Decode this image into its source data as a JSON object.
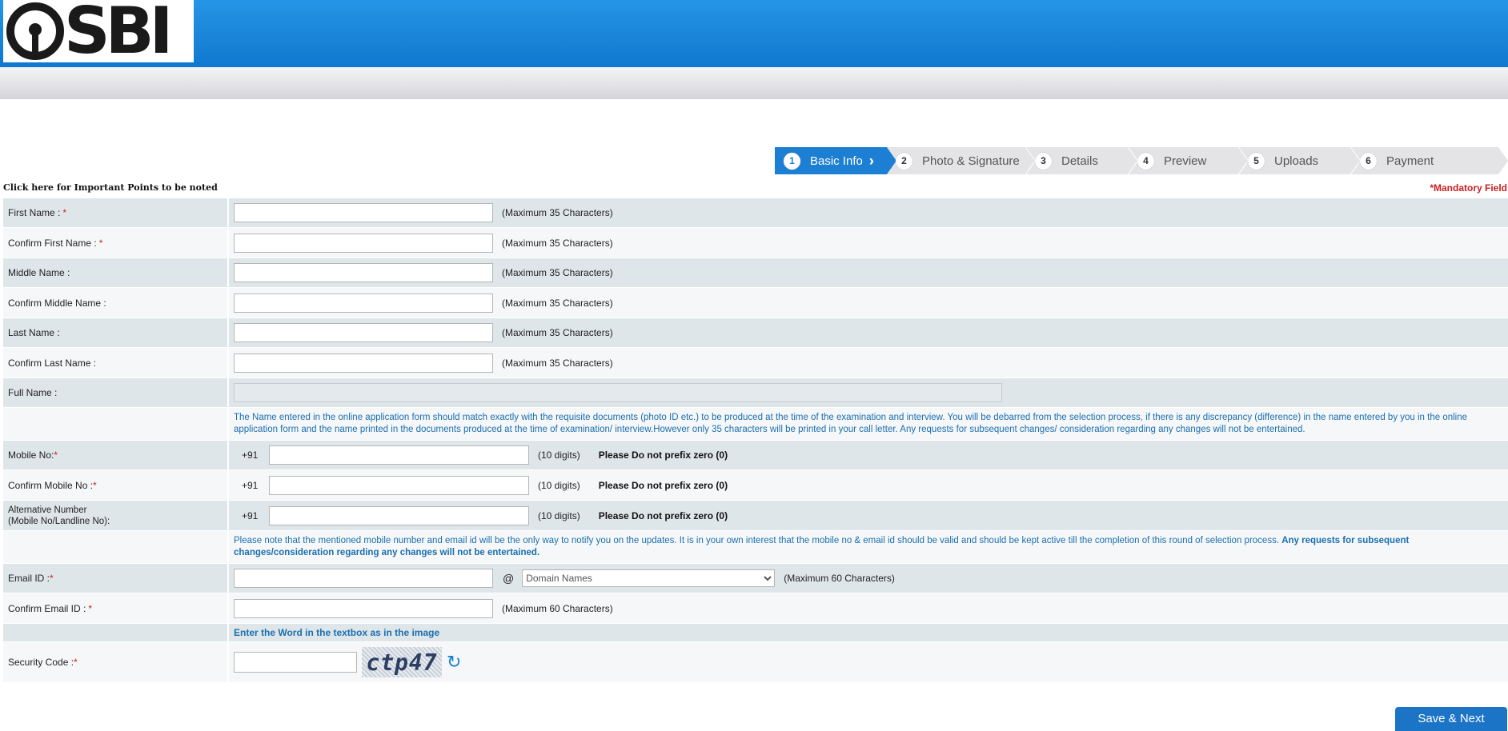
{
  "header": {
    "logo_text": "SBI"
  },
  "steps": [
    {
      "num": "1",
      "label": "Basic Info"
    },
    {
      "num": "2",
      "label": "Photo & Signature"
    },
    {
      "num": "3",
      "label": "Details"
    },
    {
      "num": "4",
      "label": "Preview"
    },
    {
      "num": "5",
      "label": "Uploads"
    },
    {
      "num": "6",
      "label": "Payment"
    }
  ],
  "important_link": "Click here for Important Points to be noted",
  "mandatory_note": "*Mandatory Field",
  "form": {
    "first_name": {
      "label": "First Name :",
      "req": "*",
      "hint": "(Maximum 35 Characters)",
      "value": ""
    },
    "confirm_first_name": {
      "label": "Confirm First Name :",
      "req": "*",
      "hint": "(Maximum 35 Characters)",
      "value": ""
    },
    "middle_name": {
      "label": "Middle Name :",
      "hint": "(Maximum 35 Characters)",
      "value": ""
    },
    "confirm_middle_name": {
      "label": "Confirm Middle Name :",
      "hint": "(Maximum 35 Characters)",
      "value": ""
    },
    "last_name": {
      "label": "Last Name :",
      "hint": "(Maximum 35 Characters)",
      "value": ""
    },
    "confirm_last_name": {
      "label": "Confirm Last Name :",
      "hint": "(Maximum 35 Characters)",
      "value": ""
    },
    "full_name": {
      "label": "Full Name :",
      "value": ""
    },
    "name_note": "The Name entered in the online application form should match exactly with the requisite documents (photo ID etc.) to be produced at the time of the examination and interview. You will be debarred from the selection process, if there is any discrepancy (difference) in the name entered by you in the online application form and the name printed in the documents produced at the time of examination/ interview.However only 35 characters will be printed in your call letter. Any requests for subsequent changes/ consideration regarding any changes will not be entertained.",
    "mobile": {
      "label": "Mobile No:",
      "req": "*",
      "prefix": "+91",
      "hint": "(10 digits)",
      "note": "Please Do not prefix zero (0)",
      "value": ""
    },
    "confirm_mobile": {
      "label": "Confirm Mobile No :",
      "req": "*",
      "prefix": "+91",
      "hint": "(10 digits)",
      "note": "Please Do not prefix zero (0)",
      "value": ""
    },
    "alt_number": {
      "label_line1": "Alternative Number",
      "label_line2": "(Mobile No/Landline No):",
      "prefix": "+91",
      "hint": "(10 digits)",
      "note": "Please Do not prefix zero (0)",
      "value": ""
    },
    "contact_note_plain": "Please note that the mentioned mobile number and email id will be the only way to notify you on the updates. It is in your own interest that the mobile no & email id should be valid and should be kept active till the completion of this round of selection process.",
    "contact_note_bold": "Any requests for subsequent changes/consideration regarding any changes will not be entertained.",
    "email": {
      "label": "Email ID :",
      "req": "*",
      "at": "@",
      "domain_placeholder": "Domain Names",
      "hint": "(Maximum 60 Characters)",
      "value": ""
    },
    "confirm_email": {
      "label": "Confirm Email ID :",
      "req": "*",
      "hint": "(Maximum 60 Characters)",
      "value": ""
    },
    "captcha_instruction": "Enter the Word in the textbox as in the image",
    "security_code": {
      "label": "Security Code :",
      "req": "*",
      "captcha_text": "ctp47",
      "value": ""
    }
  },
  "buttons": {
    "save_next": "Save & Next"
  },
  "colors": {
    "header_blue": "#1a85d8",
    "active_step": "#1d7fd3",
    "required_red": "#cc1f1f",
    "info_blue": "#1a6fb0"
  }
}
